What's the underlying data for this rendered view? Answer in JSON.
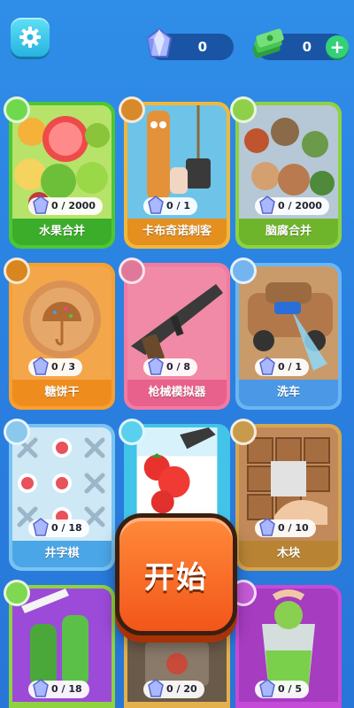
{
  "header": {
    "gem_count": "0",
    "cash_count": "0",
    "plus_label": "+"
  },
  "games": [
    {
      "name": "水果合并",
      "progress": "0 / 2000",
      "border": "#4cc832",
      "label_bg": "#3cad2a",
      "dot": "#6ed94c"
    },
    {
      "name": "卡布奇诺刺客",
      "progress": "0 / 1",
      "border": "#f2b73a",
      "label_bg": "#e58f1f",
      "dot": "#d88a2a"
    },
    {
      "name": "脑腐合并",
      "progress": "0 / 2000",
      "border": "#8fd240",
      "label_bg": "#6fb52c",
      "dot": "#8ed04a"
    },
    {
      "name": "糖饼干",
      "progress": "0 / 3",
      "border": "#f7a030",
      "label_bg": "#ee8d1e",
      "dot": "#d8861e"
    },
    {
      "name": "枪械模拟器",
      "progress": "0 / 8",
      "border": "#f37aa2",
      "label_bg": "#e8608c",
      "dot": "#e0789a"
    },
    {
      "name": "洗车",
      "progress": "0 / 1",
      "border": "#6ab6f2",
      "label_bg": "#4a98e6",
      "dot": "#74b4ef"
    },
    {
      "name": "井字棋",
      "progress": "0 / 18",
      "border": "#79c3f0",
      "label_bg": "#4aa6e6",
      "dot": "#8ac8ee"
    },
    {
      "name": "",
      "progress": "",
      "border": "#42c4e8",
      "label_bg": "#2aa8d8",
      "dot": "#5ad0ee"
    },
    {
      "name": "木块",
      "progress": "0 / 10",
      "border": "#d6a64e",
      "label_bg": "#b88434",
      "dot": "#c89a4c"
    },
    {
      "name": "",
      "progress": "0 / 18",
      "border": "#8fd240",
      "label_bg": "#6fb52c",
      "dot": "#7ed850"
    },
    {
      "name": "",
      "progress": "0 / 20",
      "border": "#e3b04c",
      "label_bg": "#c08a30",
      "dot": "#d4a44a"
    },
    {
      "name": "",
      "progress": "0 / 5",
      "border": "#c64ad8",
      "label_bg": "#a636bc",
      "dot": "#c75ad8"
    }
  ],
  "start_label": "开始",
  "icons": {
    "settings": "gear-icon",
    "gem": "crystal-gem-icon",
    "cash": "cash-stack-icon"
  }
}
